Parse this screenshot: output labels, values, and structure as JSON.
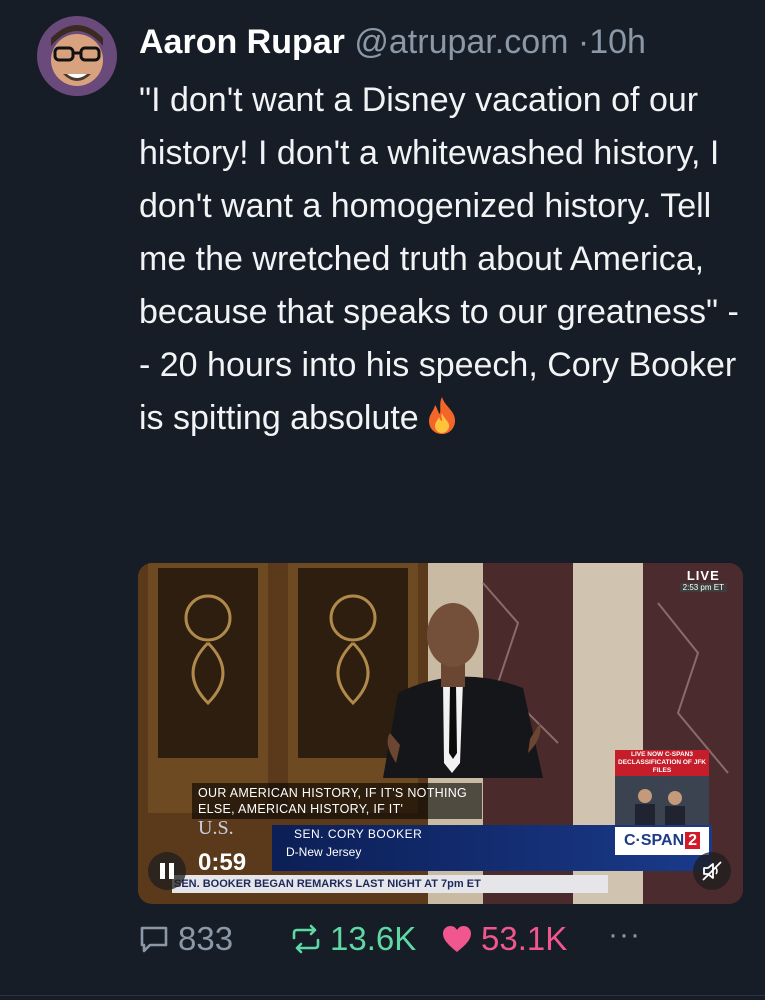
{
  "post": {
    "author_name": "Aaron Rupar",
    "handle": "@atrupar.com",
    "separator": "·",
    "age": "10h",
    "text": "\"I don't want a Disney vacation of our history! I don't a whitewashed history, I don't want a homogenized history. Tell me the wretched truth about America, because that speaks to our greatness\" -- 20 hours into his speech, Cory Booker is spitting absolute",
    "emoji_icon": "fire-icon"
  },
  "video": {
    "live_label": "LIVE",
    "live_time": "2:53 pm ET",
    "caption": "OUR AMERICAN HISTORY, IF IT'S NOTHING ELSE, AMERICAN HISTORY, IF IT'",
    "lower_third_name": "SEN. CORY BOOKER",
    "lower_third_party": "D-New Jersey",
    "us_logo": "U.S.",
    "ticker": "SEN. BOOKER BEGAN REMARKS LAST NIGHT AT 7pm ET",
    "network_logo": "C·SPAN",
    "network_number": "2",
    "live_box_label": "LIVE NOW C-SPAN3 DECLASSIFICATION OF JFK FILES",
    "timer": "0:59",
    "controls": {
      "pause_icon": "pause-icon",
      "mute_icon": "mute-icon"
    }
  },
  "actions": {
    "replies": "833",
    "reposts": "13.6K",
    "likes": "53.1K",
    "more": "···"
  },
  "colors": {
    "background": "#161d26",
    "secondary_text": "#8b98a8",
    "repost_active": "#5fd9a4",
    "like_active": "#f2568e"
  }
}
